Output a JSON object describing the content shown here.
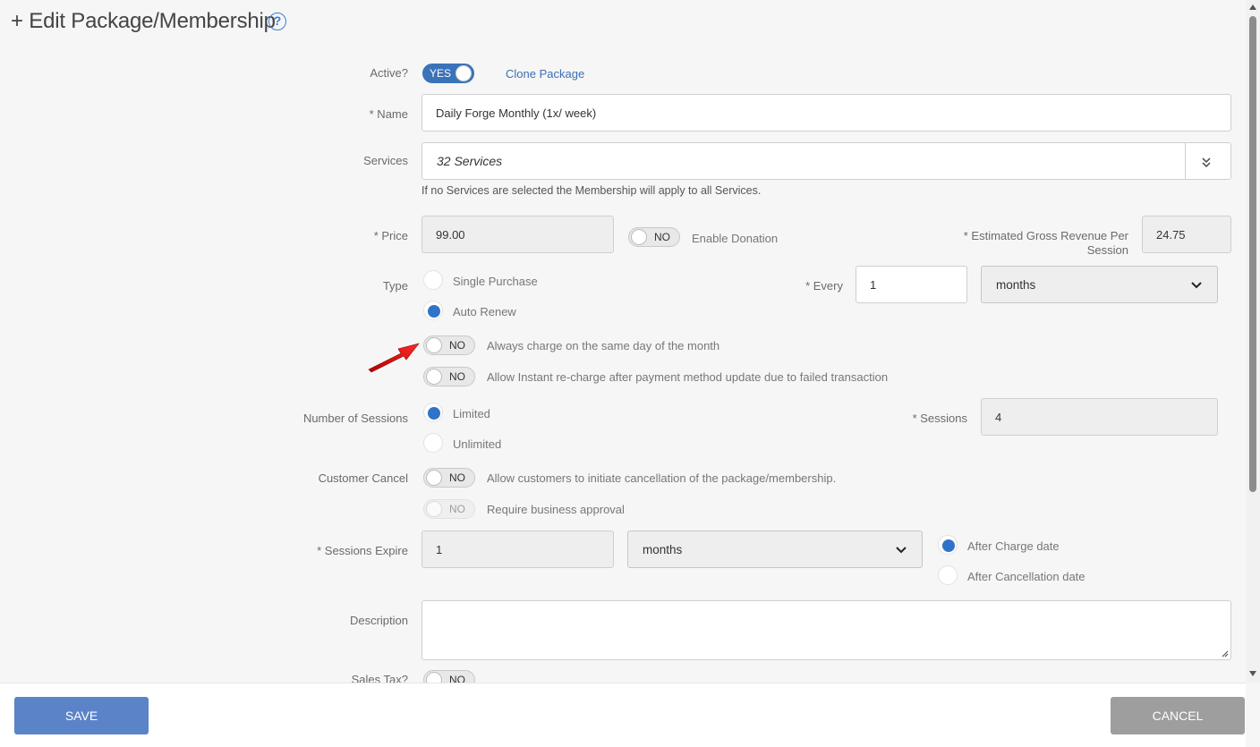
{
  "header": {
    "title": "+ Edit Package/Membership",
    "help_icon": "question-circle-icon"
  },
  "active": {
    "label": "Active?",
    "toggle": "YES",
    "clone_link": "Clone Package"
  },
  "name": {
    "label": "* Name",
    "value": "Daily Forge Monthly (1x/ week)"
  },
  "services": {
    "label": "Services",
    "value": "32 Services",
    "hint": "If no Services are selected the Membership will apply to all Services.",
    "dropdown_icon": "double-chevron-down-icon"
  },
  "price": {
    "label": "* Price",
    "value": "99.00"
  },
  "donation": {
    "toggle": "NO",
    "label": "Enable Donation"
  },
  "gross_revenue": {
    "label_line1": "* Estimated Gross Revenue Per",
    "label_line2": "Session",
    "value": "24.75"
  },
  "type": {
    "label": "Type",
    "options": [
      "Single Purchase",
      "Auto Renew"
    ],
    "selected": "Auto Renew"
  },
  "every": {
    "label": "* Every",
    "value": "1",
    "unit": "months"
  },
  "same_day": {
    "toggle": "NO",
    "label": "Always charge on the same day of the month"
  },
  "instant_recharge": {
    "toggle": "NO",
    "label": "Allow Instant re-charge after payment method update due to failed transaction"
  },
  "sessions_count": {
    "label": "Number of Sessions",
    "options": [
      "Limited",
      "Unlimited"
    ],
    "selected": "Limited"
  },
  "sessions": {
    "label": "* Sessions",
    "value": "4"
  },
  "customer_cancel": {
    "label": "Customer Cancel",
    "toggle": "NO",
    "text": "Allow customers to initiate cancellation of the package/membership."
  },
  "business_approval": {
    "toggle": "NO",
    "text": "Require business approval"
  },
  "sessions_expire": {
    "label": "* Sessions Expire",
    "value": "1",
    "unit": "months",
    "options": [
      "After Charge date",
      "After Cancellation date"
    ],
    "selected": "After Charge date"
  },
  "description": {
    "label": "Description",
    "value": ""
  },
  "sales_tax": {
    "label": "Sales Tax?",
    "toggle": "NO"
  },
  "footer": {
    "save": "SAVE",
    "cancel": "CANCEL"
  },
  "colors": {
    "accent": "#3a73b8",
    "radio": "#2f73c9",
    "save_button": "#5b83c8",
    "cancel_button": "#9e9e9e",
    "link": "#3b6fb6",
    "arrow": "#e8141b"
  }
}
